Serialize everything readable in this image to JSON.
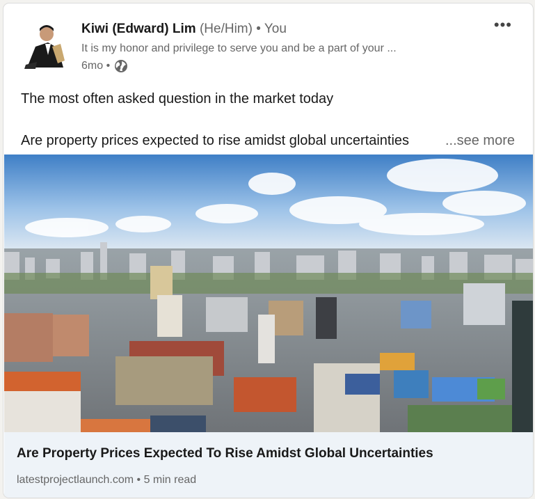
{
  "post": {
    "author": {
      "name": "Kiwi (Edward) Lim",
      "pronouns": "(He/Him)",
      "degree": "• You",
      "headline": "It is my honor and privilege to serve you and be a part of your ...",
      "time": "6mo •",
      "visibility_icon": "globe-icon"
    },
    "more_icon": "more-horizontal-icon",
    "more_label": "•••",
    "text": {
      "line1": "The most often asked question in the market today",
      "line2": "Are property prices expected to rise amidst global uncertainties",
      "see_more": "...see more"
    },
    "link": {
      "title": "Are Property Prices Expected To Rise Amidst Global Uncertainties",
      "source": "latestprojectlaunch.com • 5 min read"
    }
  },
  "colors": {
    "card_bg": "#ffffff",
    "link_footer_bg": "#eef3f8",
    "text_primary": "#191919",
    "text_secondary": "#666666"
  }
}
